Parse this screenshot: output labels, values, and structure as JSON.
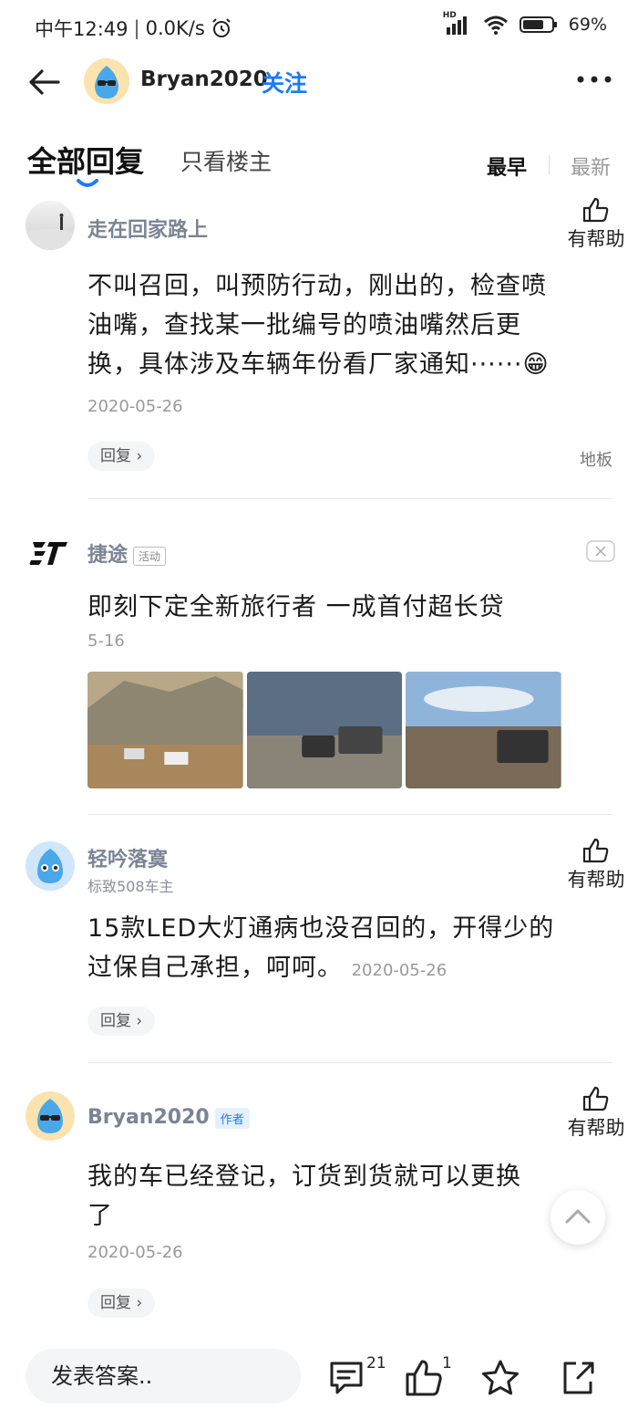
{
  "status_bar": {
    "time": "中午12:49",
    "network_speed": "0.0K/s",
    "hd_label": "HD",
    "battery": "69%"
  },
  "header": {
    "username": "Bryan2020",
    "follow_label": "关注"
  },
  "tabs": {
    "all_replies": "全部回复",
    "host_only": "只看楼主",
    "sort_earliest": "最早",
    "sort_latest": "最新"
  },
  "helpful_label": "有帮助",
  "reply_label": "回复",
  "posts": [
    {
      "username": "走在回家路上",
      "text": "不叫召回，叫预防行动，刚出的，检查喷油嘴，查找某一批编号的喷油嘴然后更换，具体涉及车辆年份看厂家通知······😁",
      "date": "2020-05-26",
      "floor": "地板"
    },
    {
      "username": "轻吟落寞",
      "subtitle": "标致508车主",
      "text": "15款LED大灯通病也没召回的，开得少的过保自己承担，呵呵。",
      "date": "2020-05-26"
    },
    {
      "username": "Bryan2020",
      "badge": "作者",
      "text": "我的车已经登记，订货到货就可以更换了",
      "date": "2020-05-26"
    }
  ],
  "ad": {
    "brand": "捷途",
    "badge": "活动",
    "title": "即刻下定全新旅行者 一成首付超长贷",
    "date": "5-16"
  },
  "bottom_bar": {
    "answer_placeholder": "发表答案..",
    "comment_count": "21",
    "like_count": "1"
  },
  "icons": [
    "back-arrow-icon",
    "more-icon",
    "thumb-up-icon",
    "close-icon",
    "chevron-up-icon",
    "comment-icon",
    "star-icon",
    "share-icon"
  ],
  "colors": {
    "accent": "#1e7cf0",
    "muted_name": "#7b8494"
  }
}
